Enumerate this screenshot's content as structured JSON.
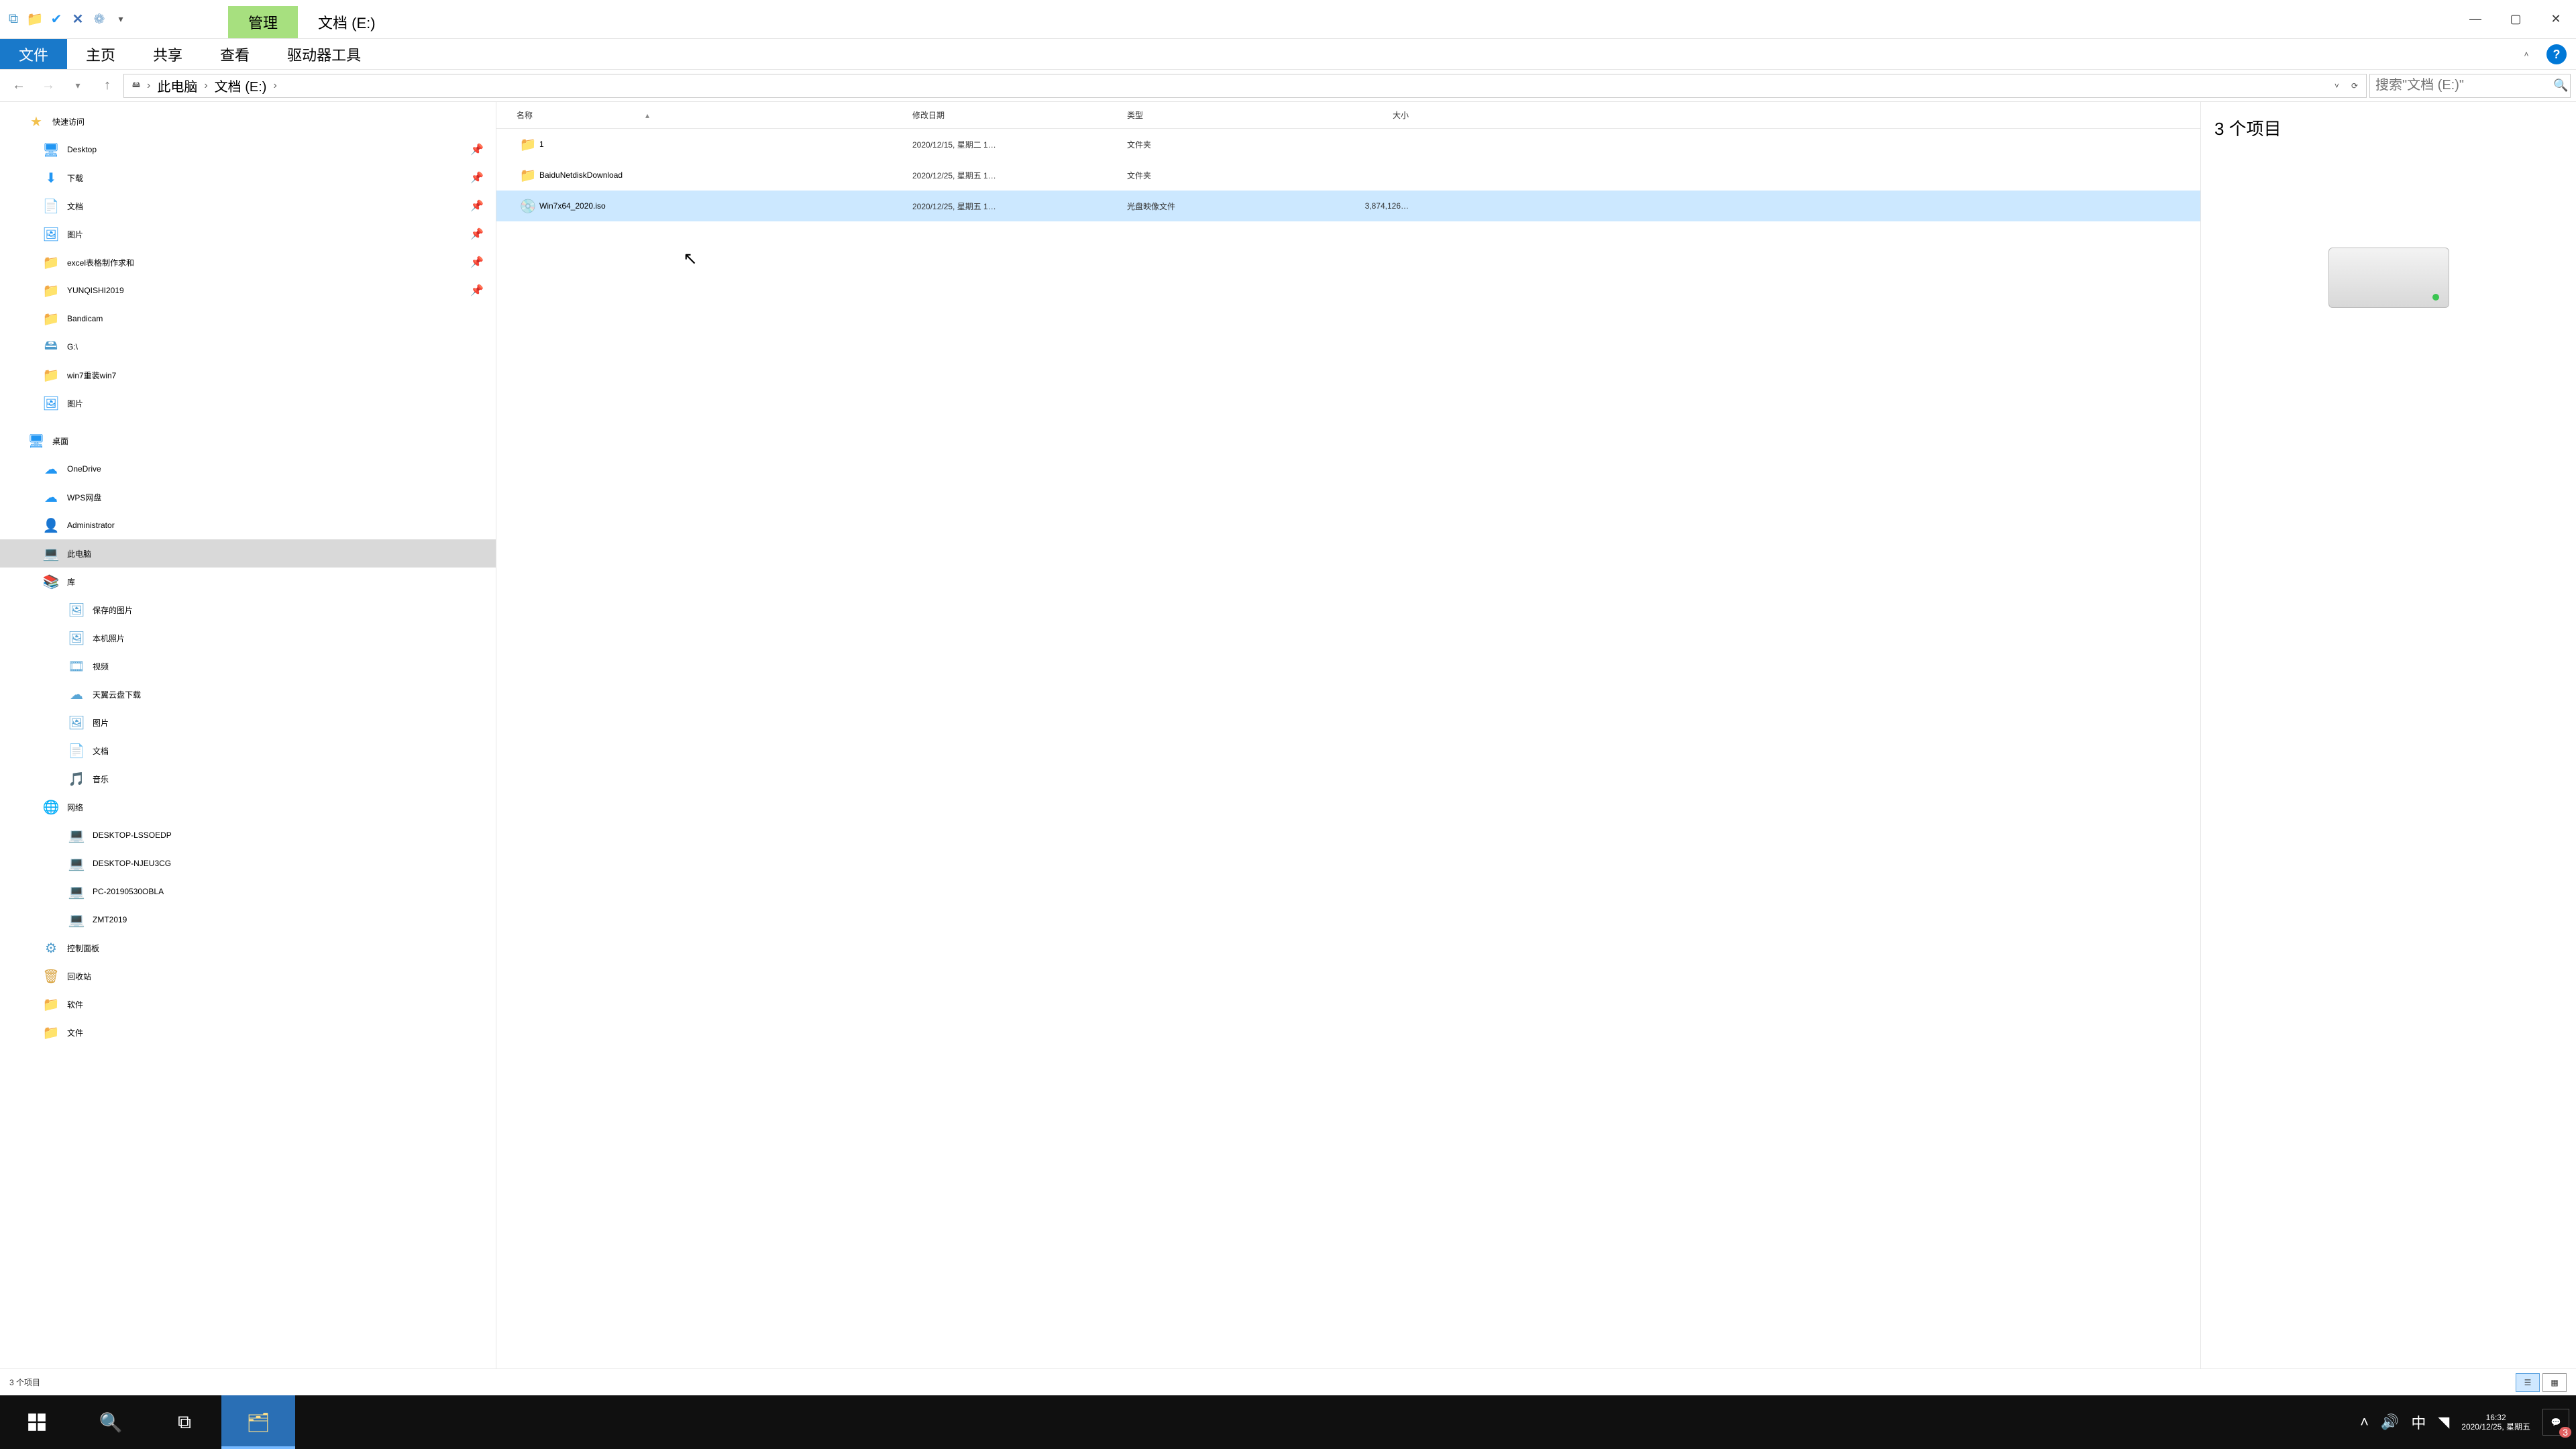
{
  "title_context": "管理",
  "title_path": "文档 (E:)",
  "ribbon": {
    "file": "文件",
    "home": "主页",
    "share": "共享",
    "view": "查看",
    "drives": "驱动器工具"
  },
  "breadcrumb": {
    "pc": "此电脑",
    "drive": "文档 (E:)"
  },
  "search_placeholder": "搜索\"文档 (E:)\"",
  "columns": {
    "name": "名称",
    "date": "修改日期",
    "type": "类型",
    "size": "大小"
  },
  "rows": [
    {
      "icon": "folder",
      "name": "1",
      "date": "2020/12/15, 星期二 1…",
      "type": "文件夹",
      "size": ""
    },
    {
      "icon": "folder",
      "name": "BaiduNetdiskDownload",
      "date": "2020/12/25, 星期五 1…",
      "type": "文件夹",
      "size": ""
    },
    {
      "icon": "iso",
      "name": "Win7x64_2020.iso",
      "date": "2020/12/25, 星期五 1…",
      "type": "光盘映像文件",
      "size": "3,874,126…",
      "selected": true
    }
  ],
  "tree": [
    {
      "kind": "node",
      "depth": 0,
      "icon": "star",
      "color": "#f2c14e",
      "label": "快速访问"
    },
    {
      "kind": "node",
      "depth": 1,
      "icon": "desktop",
      "color": "#2196f3",
      "label": "Desktop",
      "pin": true
    },
    {
      "kind": "node",
      "depth": 1,
      "icon": "download",
      "color": "#2196f3",
      "label": "下载",
      "pin": true
    },
    {
      "kind": "node",
      "depth": 1,
      "icon": "doc",
      "color": "#f2c14e",
      "label": "文档",
      "pin": true
    },
    {
      "kind": "node",
      "depth": 1,
      "icon": "pic",
      "color": "#2196f3",
      "label": "图片",
      "pin": true
    },
    {
      "kind": "node",
      "depth": 1,
      "icon": "folder",
      "color": "#f2c14e",
      "label": "excel表格制作求和",
      "pin": true
    },
    {
      "kind": "node",
      "depth": 1,
      "icon": "folder",
      "color": "#f2c14e",
      "label": "YUNQISHI2019",
      "pin": true
    },
    {
      "kind": "node",
      "depth": 1,
      "icon": "folder",
      "color": "#f2c14e",
      "label": "Bandicam"
    },
    {
      "kind": "node",
      "depth": 1,
      "icon": "drive",
      "color": "#4b9acb",
      "label": "G:\\"
    },
    {
      "kind": "node",
      "depth": 1,
      "icon": "folder",
      "color": "#f2c14e",
      "label": "win7重装win7"
    },
    {
      "kind": "node",
      "depth": 1,
      "icon": "pic",
      "color": "#2196f3",
      "label": "图片"
    },
    {
      "kind": "spacer"
    },
    {
      "kind": "node",
      "depth": 0,
      "icon": "desktop",
      "color": "#2196f3",
      "label": "桌面"
    },
    {
      "kind": "node",
      "depth": 1,
      "icon": "cloud",
      "color": "#2196f3",
      "label": "OneDrive"
    },
    {
      "kind": "node",
      "depth": 1,
      "icon": "cloud",
      "color": "#2196f3",
      "label": "WPS网盘"
    },
    {
      "kind": "node",
      "depth": 1,
      "icon": "user",
      "color": "#d9a441",
      "label": "Administrator"
    },
    {
      "kind": "node",
      "depth": 1,
      "icon": "pc",
      "color": "#2196f3",
      "label": "此电脑",
      "selected": true
    },
    {
      "kind": "node",
      "depth": 1,
      "icon": "lib",
      "color": "#d9a441",
      "label": "库"
    },
    {
      "kind": "node",
      "depth": 2,
      "icon": "pic",
      "color": "#5aa6d6",
      "label": "保存的图片"
    },
    {
      "kind": "node",
      "depth": 2,
      "icon": "pic",
      "color": "#5aa6d6",
      "label": "本机照片"
    },
    {
      "kind": "node",
      "depth": 2,
      "icon": "video",
      "color": "#5aa6d6",
      "label": "视频"
    },
    {
      "kind": "node",
      "depth": 2,
      "icon": "cloud",
      "color": "#5aa6d6",
      "label": "天翼云盘下载"
    },
    {
      "kind": "node",
      "depth": 2,
      "icon": "pic",
      "color": "#5aa6d6",
      "label": "图片"
    },
    {
      "kind": "node",
      "depth": 2,
      "icon": "doc",
      "color": "#5aa6d6",
      "label": "文档"
    },
    {
      "kind": "node",
      "depth": 2,
      "icon": "music",
      "color": "#5aa6d6",
      "label": "音乐"
    },
    {
      "kind": "node",
      "depth": 1,
      "icon": "net",
      "color": "#2196f3",
      "label": "网络"
    },
    {
      "kind": "node",
      "depth": 2,
      "icon": "pc",
      "color": "#5aa6d6",
      "label": "DESKTOP-LSSOEDP"
    },
    {
      "kind": "node",
      "depth": 2,
      "icon": "pc",
      "color": "#5aa6d6",
      "label": "DESKTOP-NJEU3CG"
    },
    {
      "kind": "node",
      "depth": 2,
      "icon": "pc",
      "color": "#5aa6d6",
      "label": "PC-20190530OBLA"
    },
    {
      "kind": "node",
      "depth": 2,
      "icon": "pc",
      "color": "#5aa6d6",
      "label": "ZMT2019"
    },
    {
      "kind": "node",
      "depth": 1,
      "icon": "panel",
      "color": "#4b9acb",
      "label": "控制面板"
    },
    {
      "kind": "node",
      "depth": 1,
      "icon": "bin",
      "color": "#d9a441",
      "label": "回收站"
    },
    {
      "kind": "node",
      "depth": 1,
      "icon": "folder",
      "color": "#f2c14e",
      "label": "软件"
    },
    {
      "kind": "node",
      "depth": 1,
      "icon": "folder",
      "color": "#f2c14e",
      "label": "文件"
    }
  ],
  "preview_count": "3 个项目",
  "status_text": "3 个项目",
  "tray": {
    "ime": "中",
    "time": "16:32",
    "date": "2020/12/25, 星期五",
    "notif_badge": "3"
  }
}
